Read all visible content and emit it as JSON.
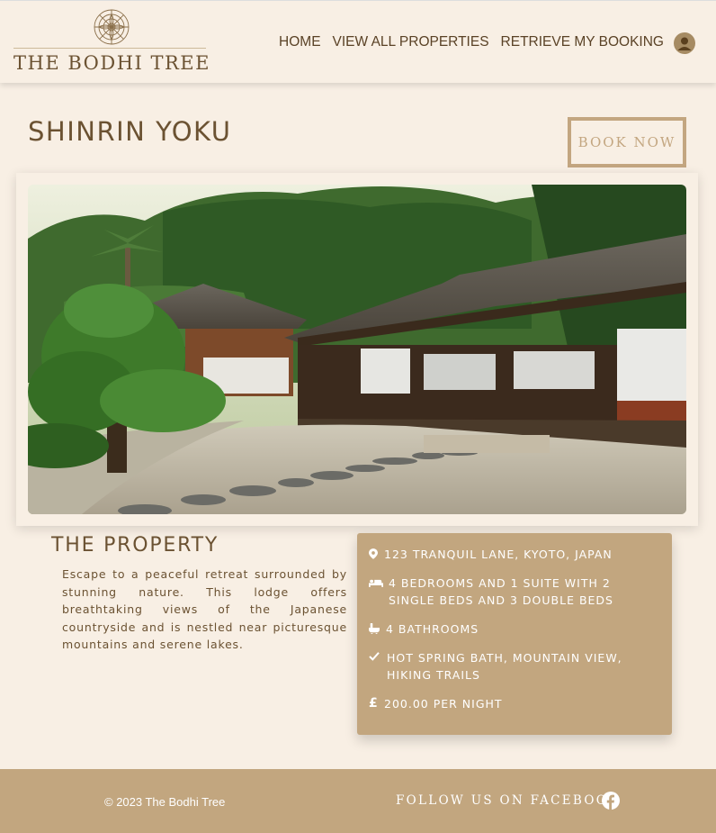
{
  "brand": {
    "name": "THE BODHI TREE"
  },
  "nav": {
    "items": [
      "HOME",
      "VIEW ALL PROPERTIES",
      "RETRIEVE MY BOOKING"
    ]
  },
  "icons": {
    "logo": "mandala-logo-icon",
    "account": "user-account-icon",
    "location": "map-marker-icon",
    "bed": "bed-icon",
    "bath": "bath-icon",
    "amenities": "check-icon",
    "price": "pound-icon",
    "social": "facebook-icon"
  },
  "colors": {
    "background": "#f8efe4",
    "accent": "#c2a67f",
    "text": "#6b5232"
  },
  "property": {
    "title": "SHINRIN YOKU",
    "book_label": "BOOK NOW",
    "section_heading": "THE PROPERTY",
    "description": "Escape to a peaceful retreat surrounded by stunning nature. This lodge offers breathtaking views of the Japanese countryside and is nestled near picturesque mountains and serene lakes.",
    "details": {
      "address": "123 Tranquil Lane, Kyoto, Japan",
      "bedrooms": "4 bedrooms and 1 suite with 2 single beds and 3 double beds",
      "bathrooms": "4 bathrooms",
      "amenities": "Hot spring bath, Mountain view, Hiking trails",
      "price": "200.00 per night"
    }
  },
  "footer": {
    "copyright": "© 2023 The Bodhi Tree",
    "follow": "FOLLOW US ON FACEBOOK"
  }
}
